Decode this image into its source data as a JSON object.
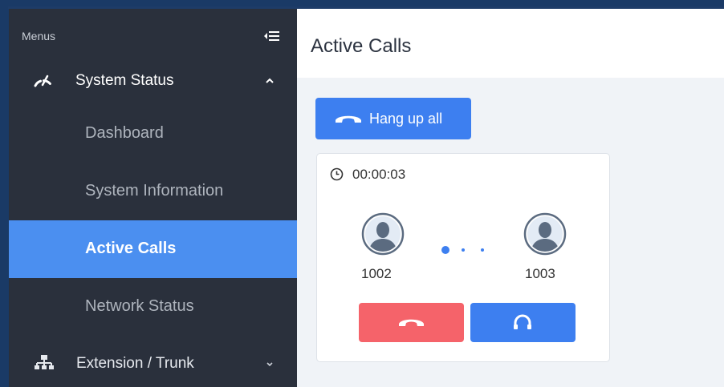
{
  "sidebar": {
    "menus_label": "Menus",
    "sections": [
      {
        "label": "System Status",
        "icon": "speedometer-icon",
        "expanded": true
      },
      {
        "label": "Extension / Trunk",
        "icon": "network-tree-icon",
        "expanded": false
      }
    ],
    "items": [
      {
        "label": "Dashboard",
        "active": false
      },
      {
        "label": "System Information",
        "active": false
      },
      {
        "label": "Active Calls",
        "active": true
      },
      {
        "label": "Network Status",
        "active": false
      }
    ]
  },
  "header": {
    "title": "Active Calls"
  },
  "toolbar": {
    "hangup_all_label": "Hang up all"
  },
  "call": {
    "duration": "00:00:03",
    "caller": "1002",
    "callee": "1003"
  },
  "colors": {
    "sidebar_bg": "#2a303c",
    "active_item": "#4b8ff0",
    "primary_button": "#3d7ff0",
    "danger_button": "#f5636a"
  }
}
